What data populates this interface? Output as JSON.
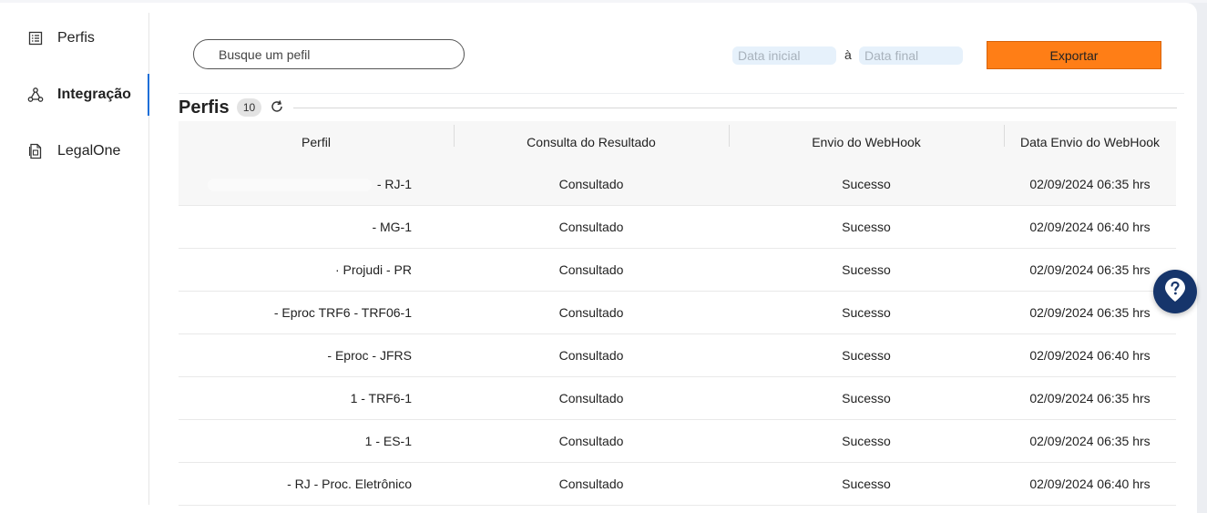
{
  "sidebar": {
    "items": [
      {
        "label": "Perfis",
        "icon": "list-icon"
      },
      {
        "label": "Integração",
        "icon": "network-icon",
        "active": true
      },
      {
        "label": "LegalOne",
        "icon": "document-icon"
      }
    ]
  },
  "toolbar": {
    "search_placeholder": "Busque um pefil",
    "date_start_placeholder": "Data inicial",
    "date_separator": "à",
    "date_end_placeholder": "Data final",
    "export_label": "Exportar"
  },
  "section": {
    "title": "Perfis",
    "count": "10"
  },
  "table": {
    "columns": [
      "Perfil",
      "Consulta do Resultado",
      "Envio do WebHook",
      "Data Envio do WebHook"
    ],
    "rows": [
      [
        "- RJ-1",
        "Consultado",
        "Sucesso",
        "02/09/2024 06:35 hrs"
      ],
      [
        "- MG-1",
        "Consultado",
        "Sucesso",
        "02/09/2024 06:40 hrs"
      ],
      [
        "· Projudi - PR",
        "Consultado",
        "Sucesso",
        "02/09/2024 06:35 hrs"
      ],
      [
        "- Eproc TRF6 - TRF06-1",
        "Consultado",
        "Sucesso",
        "02/09/2024 06:35 hrs"
      ],
      [
        "- Eproc - JFRS",
        "Consultado",
        "Sucesso",
        "02/09/2024 06:40 hrs"
      ],
      [
        "1 - TRF6-1",
        "Consultado",
        "Sucesso",
        "02/09/2024 06:35 hrs"
      ],
      [
        "1 - ES-1",
        "Consultado",
        "Sucesso",
        "02/09/2024 06:35 hrs"
      ],
      [
        "- RJ - Proc. Eletrônico",
        "Consultado",
        "Sucesso",
        "02/09/2024 06:40 hrs"
      ]
    ]
  },
  "colors": {
    "accent": "#ff7e16",
    "active_indicator": "#1d6fd8",
    "help_button": "#16356b"
  }
}
